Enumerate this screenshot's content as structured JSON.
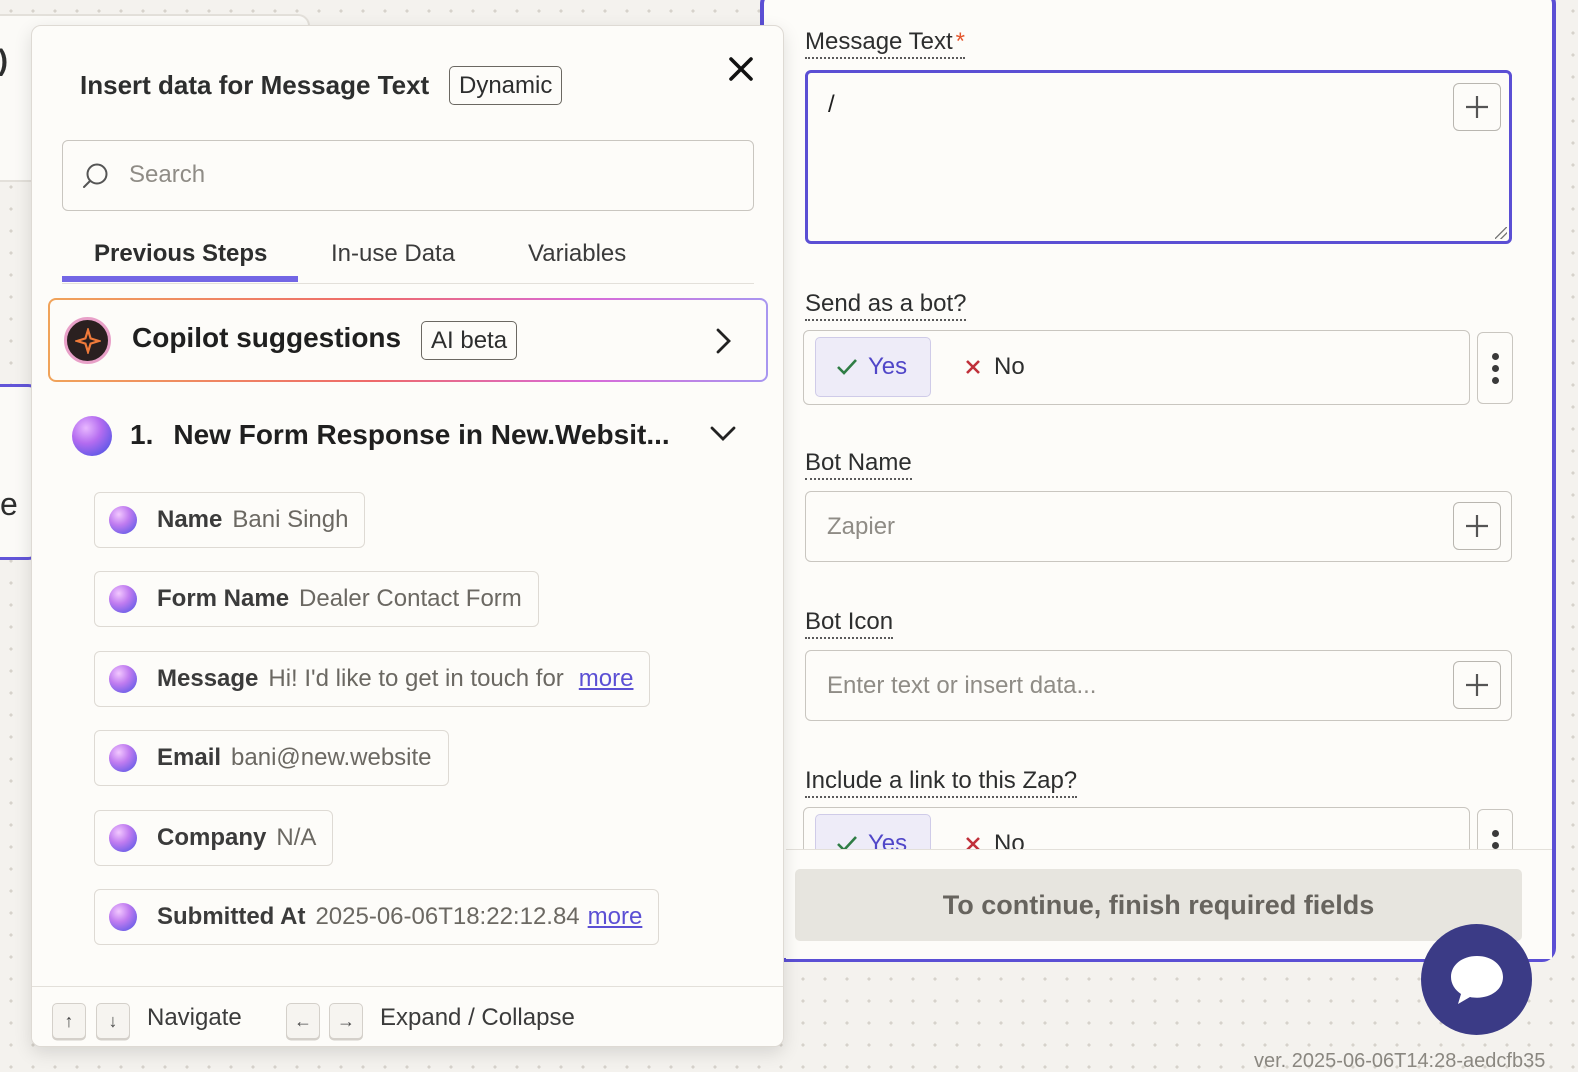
{
  "background": {
    "left_card_fragment": ")",
    "left_mid_fragment": "e"
  },
  "popover": {
    "title": "Insert data for Message Text",
    "badge": "Dynamic",
    "search_placeholder": "Search",
    "tabs": [
      {
        "label": "Previous Steps",
        "active": true
      },
      {
        "label": "In-use Data",
        "active": false
      },
      {
        "label": "Variables",
        "active": false
      }
    ],
    "copilot": {
      "title": "Copilot suggestions",
      "badge": "AI beta"
    },
    "step": {
      "number": "1.",
      "title": "New Form Response in New.Websit..."
    },
    "fields": [
      {
        "key": "Name",
        "value": "Bani Singh",
        "more": ""
      },
      {
        "key": "Form Name",
        "value": "Dealer Contact Form",
        "more": ""
      },
      {
        "key": "Message",
        "value": "Hi! I'd like to get in touch for",
        "more": "more"
      },
      {
        "key": "Email",
        "value": "bani@new.website",
        "more": ""
      },
      {
        "key": "Company",
        "value": "N/A",
        "more": ""
      },
      {
        "key": "Submitted At",
        "value": "2025-06-06T18:22:12.84",
        "more": "more"
      }
    ],
    "footer": {
      "up_key": "↑",
      "down_key": "↓",
      "navigate_label": "Navigate",
      "left_key": "←",
      "right_key": "→",
      "expand_label": "Expand / Collapse"
    }
  },
  "form": {
    "message_text": {
      "label": "Message Text",
      "required_mark": "*",
      "value": "/"
    },
    "send_as_bot": {
      "label": "Send as a bot?",
      "yes": "Yes",
      "no": "No",
      "selected": "Yes"
    },
    "bot_name": {
      "label": "Bot Name",
      "placeholder": "Zapier"
    },
    "bot_icon": {
      "label": "Bot Icon",
      "placeholder": "Enter text or insert data..."
    },
    "include_link": {
      "label": "Include a link to this Zap?",
      "yes": "Yes",
      "no": "No",
      "selected": "Yes"
    },
    "continue_button": "To continue, finish required fields"
  },
  "version": "ver. 2025-06-06T14:28-aedcfb35",
  "colors": {
    "accent": "#5b4fd4",
    "tab_underline": "#7366e5",
    "required": "#e4572e",
    "chat_button": "#3b3b86"
  }
}
